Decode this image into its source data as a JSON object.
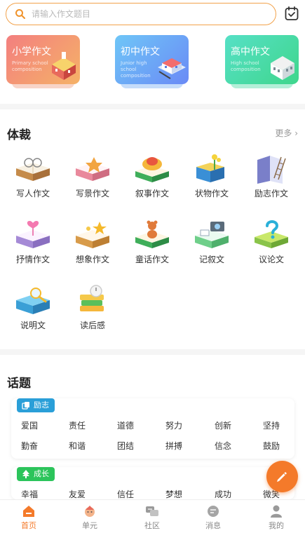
{
  "search": {
    "placeholder": "请输入作文题目"
  },
  "banners": [
    {
      "title": "小学作文",
      "subtitle": "Primary school composition"
    },
    {
      "title": "初中作文",
      "subtitle": "Junior high school composition"
    },
    {
      "title": "高中作文",
      "subtitle": "High school composition"
    }
  ],
  "genre_section": {
    "title": "体裁",
    "more": "更多",
    "items": [
      "写人作文",
      "写景作文",
      "叙事作文",
      "状物作文",
      "励志作文",
      "抒情作文",
      "想象作文",
      "童话作文",
      "记叙文",
      "议论文",
      "说明文",
      "读后感"
    ]
  },
  "topic_section": {
    "title": "话题",
    "groups": [
      {
        "tag": "励志",
        "tag_color": "#2a9fd8",
        "words": [
          "爱国",
          "责任",
          "道德",
          "努力",
          "创新",
          "坚持",
          "勤奋",
          "和谐",
          "团结",
          "拼搏",
          "信念",
          "鼓励"
        ]
      },
      {
        "tag": "成长",
        "tag_color": "#2cc45b",
        "words": [
          "幸福",
          "友爱",
          "信任",
          "梦想",
          "成功",
          "微笑"
        ]
      }
    ]
  },
  "tabbar": {
    "items": [
      "首页",
      "单元",
      "社区",
      "消息",
      "我的"
    ],
    "active": "首页",
    "active_color": "#f47a2a"
  },
  "accent_color": "#f47a2a"
}
